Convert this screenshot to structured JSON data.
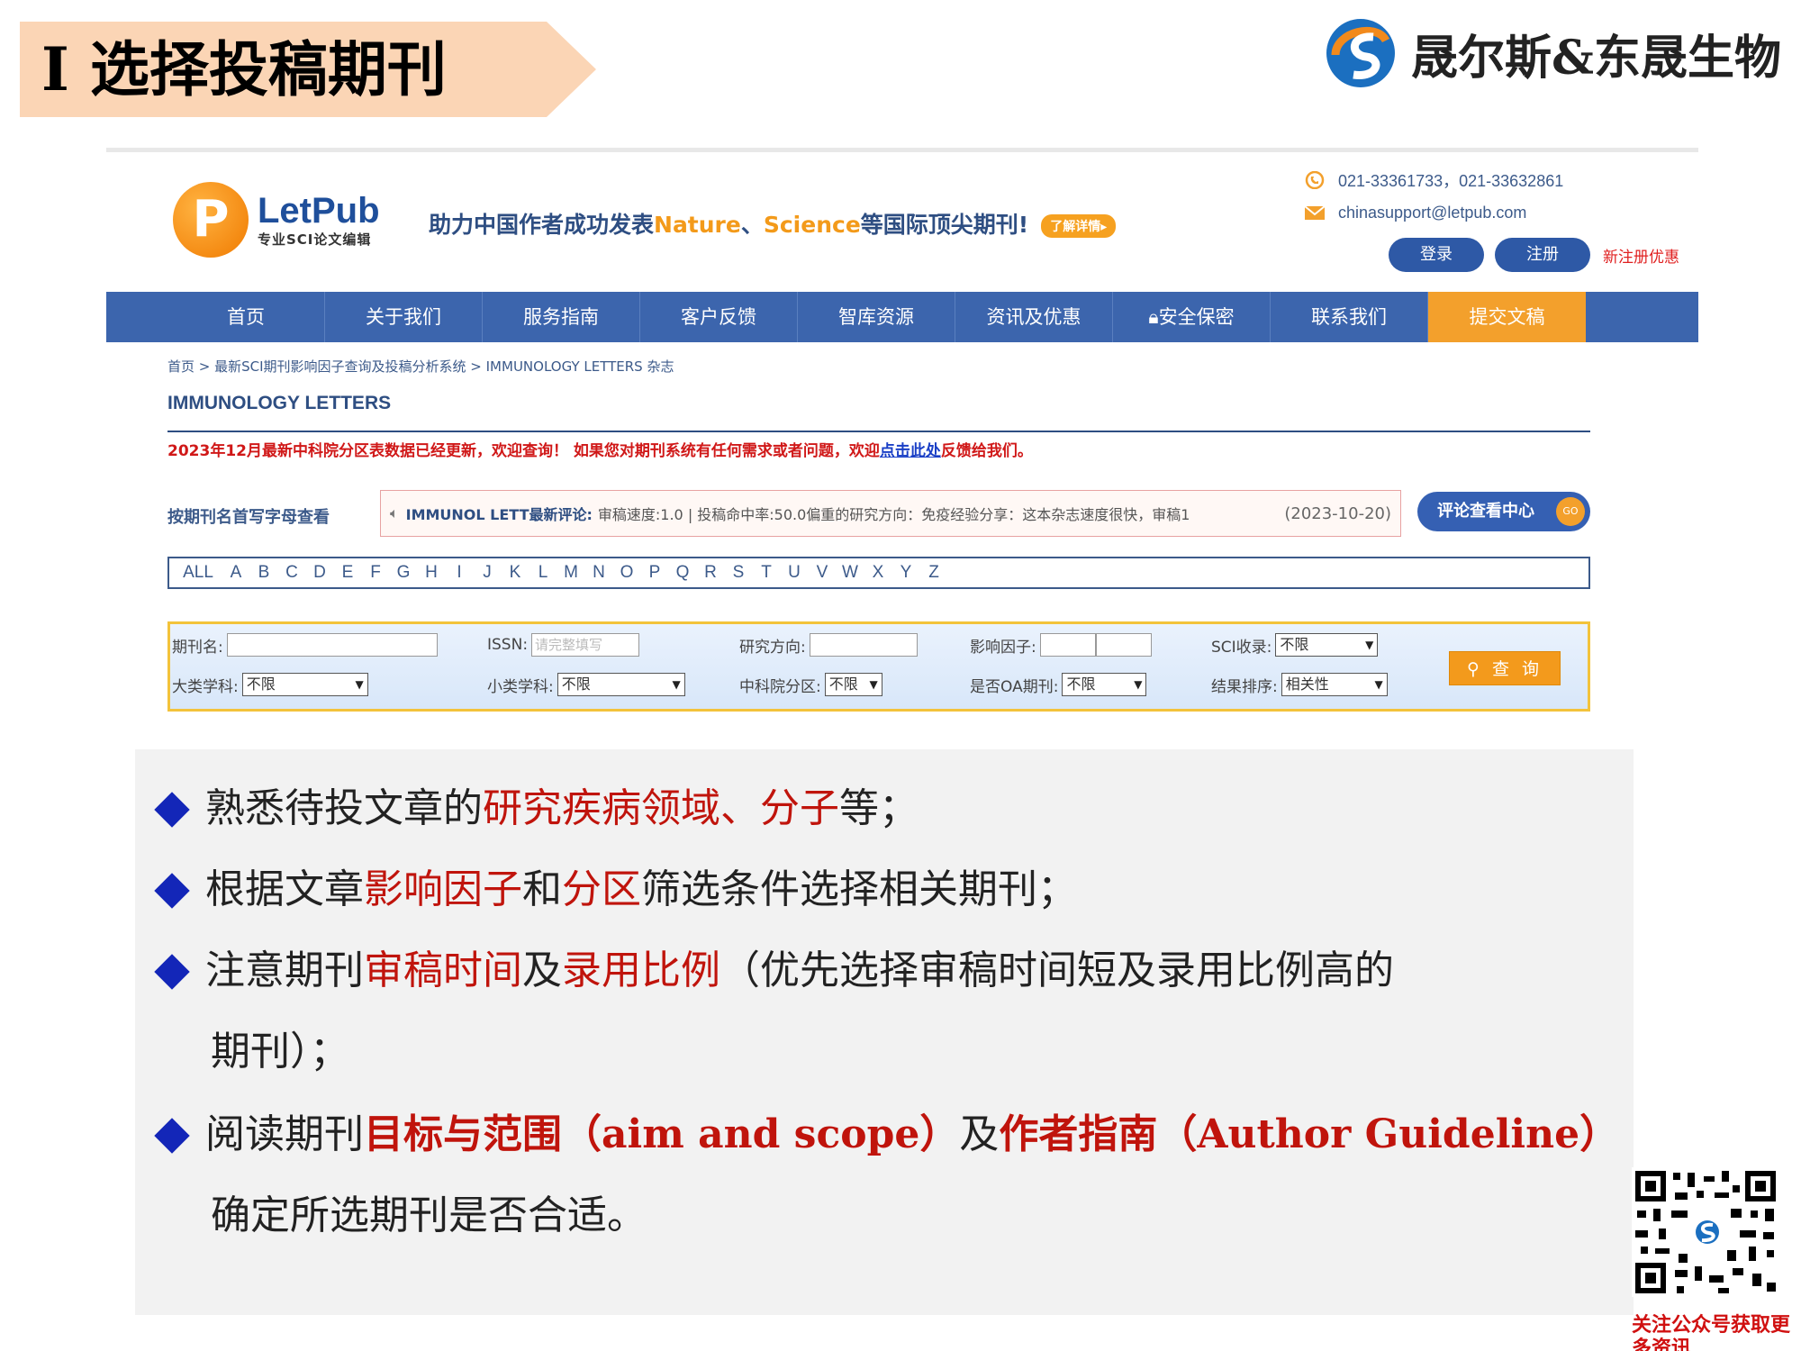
{
  "slide": {
    "title": "I 选择投稿期刊",
    "brand_name": "晟尔斯&东晟生物",
    "brand_logo": "S-swirl-logo",
    "banner_color": "#fbd5b5"
  },
  "site": {
    "logo_letter": "P",
    "logo_name": "LetPub",
    "logo_sub": "专业SCI论文编辑",
    "slogan_part1": "助力中国作者成功发表",
    "slogan_nature": "Nature",
    "slogan_sep": "、",
    "slogan_science": "Science",
    "slogan_part2": "等国际顶尖期刊!",
    "more_badge": "了解详情▸",
    "phone": "021-33361733，021-33632861",
    "email": "chinasupport@letpub.com",
    "login": "登录",
    "register": "注册",
    "register_promo": "新注册优惠",
    "nav": [
      "首页",
      "关于我们",
      "服务指南",
      "客户反馈",
      "智库资源",
      "资讯及优惠",
      "安全保密",
      "联系我们",
      "提交文稿"
    ],
    "breadcrumb": "首页 > 最新SCI期刊影响因子查询及投稿分析系统 > IMMUNOLOGY LETTERS 杂志",
    "journal_title": "IMMUNOLOGY LETTERS",
    "notice_part1": "2023年12月最新中科院分区表数据已经更新，欢迎查询！ 如果您对期刊系统有任何需求或者问题，欢迎",
    "notice_link": "点击此处",
    "notice_part2": "反馈给我们。",
    "letter_label": "按期刊名首写字母查看",
    "review_journal": "IMMUNOL LETT最新评论:",
    "review_text": "审稿速度:1.0 | 投稿命中率:50.0偏重的研究方向：免疫经验分享：这本杂志速度很快，审稿1",
    "review_date": "(2023-10-20)",
    "review_center": "评论查看中心",
    "review_go": "GO",
    "alphabet": [
      "ALL",
      "A",
      "B",
      "C",
      "D",
      "E",
      "F",
      "G",
      "H",
      "I",
      "J",
      "K",
      "L",
      "M",
      "N",
      "O",
      "P",
      "Q",
      "R",
      "S",
      "T",
      "U",
      "V",
      "W",
      "X",
      "Y",
      "Z"
    ],
    "search": {
      "name_label": "期刊名:",
      "issn_label": "ISSN:",
      "issn_placeholder": "请完整填写",
      "field_label": "研究方向:",
      "if_label": "影响因子:",
      "sci_label": "SCI收录:",
      "sci_value": "不限",
      "major_label": "大类学科:",
      "major_value": "不限",
      "minor_label": "小类学科:",
      "minor_value": "不限",
      "cas_label": "中科院分区:",
      "cas_value": "不限",
      "oa_label": "是否OA期刊:",
      "oa_value": "不限",
      "sort_label": "结果排序:",
      "sort_value": "相关性",
      "button": "查 询"
    }
  },
  "bullets": {
    "b1_a": "熟悉待投文章的",
    "b1_b": "研究疾病领域、分子",
    "b1_c": "等；",
    "b2_a": "根据文章",
    "b2_b": "影响因子",
    "b2_c": "和",
    "b2_d": "分区",
    "b2_e": "筛选条件选择相关期刊；",
    "b3_a": "注意期刊",
    "b3_b": "审稿时间",
    "b3_c": "及",
    "b3_d": "录用比例",
    "b3_e": "（优先选择审稿时间短及录用比例高的",
    "b3_cont": "期刊）；",
    "b4_a": "阅读期刊",
    "b4_b": "目标与范围（aim and scope）",
    "b4_c": "及",
    "b4_d": "作者指南（Author Guideline）",
    "b4_cont": "确定所选期刊是否合适。"
  },
  "qr": {
    "caption": "关注公众号获取更多资讯"
  }
}
